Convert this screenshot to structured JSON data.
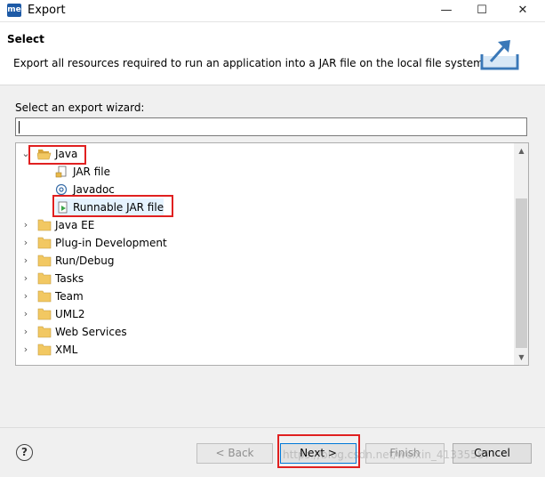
{
  "window": {
    "app_icon_text": "me",
    "title": "Export",
    "minimize_glyph": "—",
    "maximize_glyph": "☐",
    "close_glyph": "✕"
  },
  "banner": {
    "title": "Select",
    "description": "Export all resources required to run an application into a JAR file on the local file system.",
    "icon": "export-icon"
  },
  "wizard": {
    "label": "Select an export wizard:",
    "filter_value": "",
    "tree": [
      {
        "label": "Java",
        "expanded": true
      },
      {
        "label": "JAR file"
      },
      {
        "label": "Javadoc"
      },
      {
        "label": "Runnable JAR file",
        "selected": true
      },
      {
        "label": "Java EE"
      },
      {
        "label": "Plug-in Development"
      },
      {
        "label": "Run/Debug"
      },
      {
        "label": "Tasks"
      },
      {
        "label": "Team"
      },
      {
        "label": "UML2"
      },
      {
        "label": "Web Services"
      },
      {
        "label": "XML"
      }
    ]
  },
  "footer": {
    "help_label": "?",
    "back_label": "< Back",
    "next_label": "Next >",
    "finish_label": "Finish",
    "cancel_label": "Cancel",
    "watermark": "https://blog.csdn.net/weixin_41335587"
  },
  "colors": {
    "highlight_box": "#e02020",
    "selection": "#e5f3ff",
    "folder": "#e8b84a"
  }
}
